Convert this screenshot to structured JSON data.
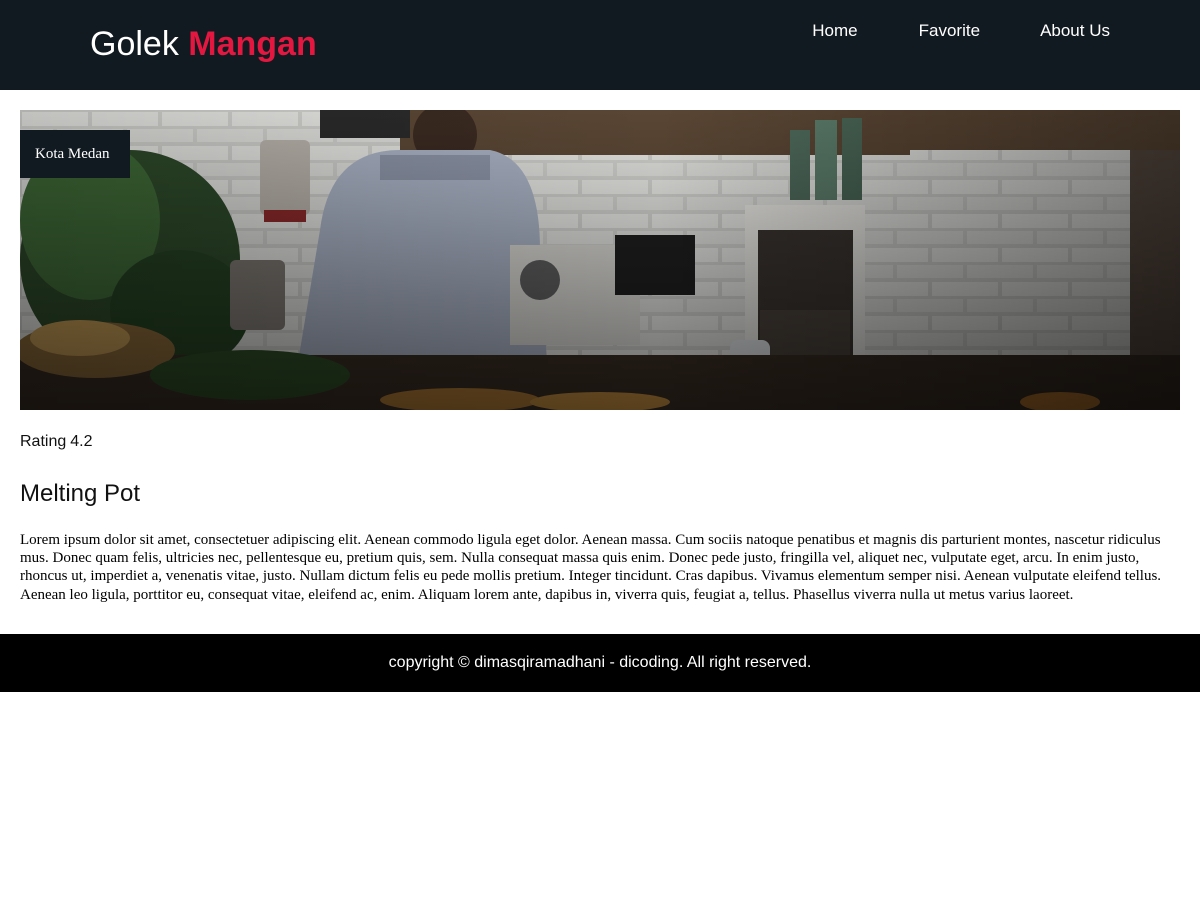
{
  "header": {
    "brand_primary": "Golek",
    "brand_accent": "Mangan",
    "brand_accent_color": "#e3173f",
    "background_color": "#121a21"
  },
  "nav": {
    "items": [
      {
        "label": "Home"
      },
      {
        "label": "Favorite"
      },
      {
        "label": "About Us"
      }
    ]
  },
  "restaurant": {
    "city": "Kota Medan",
    "rating_label": "Rating",
    "rating_value": "4.2",
    "name": "Melting Pot",
    "description": "Lorem ipsum dolor sit amet, consectetuer adipiscing elit. Aenean commodo ligula eget dolor. Aenean massa. Cum sociis natoque penatibus et magnis dis parturient montes, nascetur ridiculus mus. Donec quam felis, ultricies nec, pellentesque eu, pretium quis, sem. Nulla consequat massa quis enim. Donec pede justo, fringilla vel, aliquet nec, vulputate eget, arcu. In enim justo, rhoncus ut, imperdiet a, venenatis vitae, justo. Nullam dictum felis eu pede mollis pretium. Integer tincidunt. Cras dapibus. Vivamus elementum semper nisi. Aenean vulputate eleifend tellus. Aenean leo ligula, porttitor eu, consequat vitae, eleifend ac, enim. Aliquam lorem ante, dapibus in, viverra quis, feugiat a, tellus. Phasellus viverra nulla ut metus varius laoreet."
  },
  "footer": {
    "text": "copyright © dimasqiramadhani - dicoding. All right reserved."
  }
}
